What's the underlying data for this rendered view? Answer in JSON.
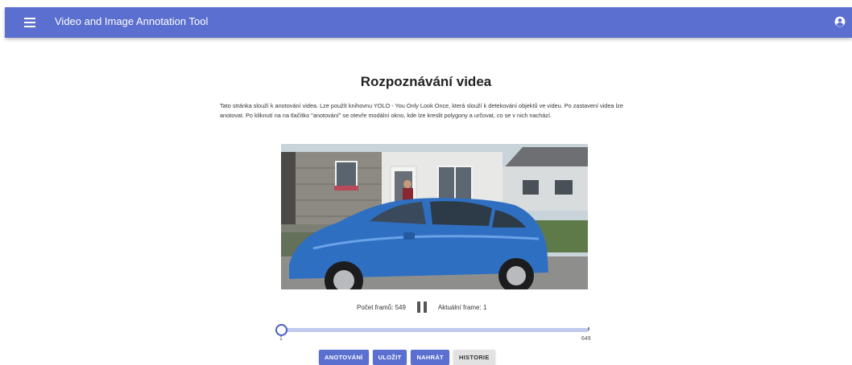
{
  "app": {
    "title": "Video and Image Annotation Tool"
  },
  "page": {
    "title": "Rozpoznávání videa",
    "description": "Tato stránka slouží k anotování videa. Lze použít knihovnu YOLO - You Only Look Once, která slouží k detekování objektů ve videu. Po zastavení videa lze anotovat. Po kliknutí na na tlačítko \"anotování\" se otevře modální okno, kde lze kreslit polygony a určovat, co se v nich nachází."
  },
  "player": {
    "frame_count_label": "Počet framů: 549",
    "current_frame_label": "Aktuální frame: 1",
    "slider": {
      "min_label": "1",
      "max_label": "649",
      "value": 1
    }
  },
  "actions": {
    "annotate_label": "ANOTOVÁNÍ",
    "save_label": "ULOŽIT",
    "upload_label": "NAHRÁT",
    "history_label": "HISTORIE"
  },
  "colors": {
    "primary": "#5a6fcf",
    "slider_track": "#c1c9ee",
    "secondary_button": "#e2e2e2"
  }
}
